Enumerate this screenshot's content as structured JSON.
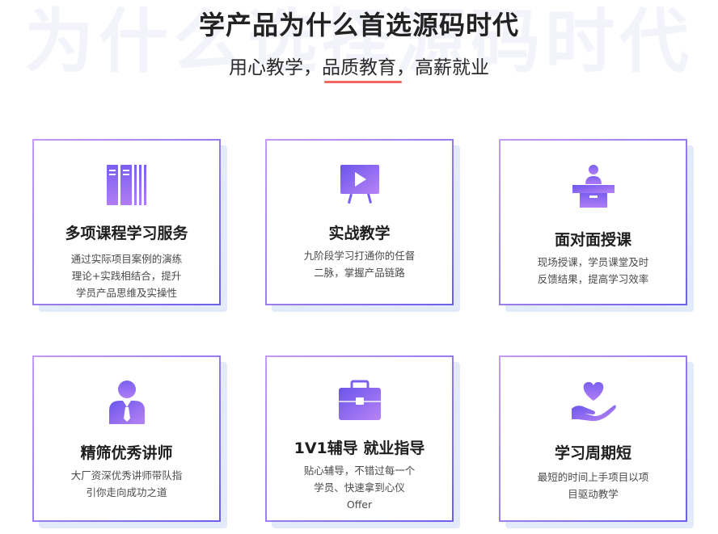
{
  "header": {
    "watermark": "为什么选择源码时代",
    "title": "学产品为什么首选源码时代",
    "subtitle": "用心教学，品质教育，高薪就业"
  },
  "colors": {
    "accent_purple": "#8a5cf0",
    "accent_red": "#f0685f",
    "shadow": "#e3ebfb"
  },
  "cards": [
    {
      "icon": "books-icon",
      "title": "多项课程学习服务",
      "desc": [
        "通过实际项目案例的演练",
        "理论+实践相结合，提升",
        "学员产品思维及实操性"
      ]
    },
    {
      "icon": "presentation-board-icon",
      "title": "实战教学",
      "desc": [
        "九阶段学习打通你的任督",
        "二脉，掌握产品链路"
      ]
    },
    {
      "icon": "lecturer-podium-icon",
      "title": "面对面授课",
      "desc": [
        "现场授课，学员课堂及时",
        "反馈结果，提高学习效率"
      ]
    },
    {
      "icon": "instructor-icon",
      "title": "精筛优秀讲师",
      "desc": [
        "大厂资深优秀讲师带队指",
        "引你走向成功之道"
      ]
    },
    {
      "icon": "briefcase-icon",
      "title": "1V1辅导 就业指导",
      "desc": [
        "贴心辅导，不错过每一个",
        "学员、快速拿到心仪",
        "Offer"
      ]
    },
    {
      "icon": "heart-hand-icon",
      "title": "学习周期短",
      "desc": [
        "最短的时间上手项目以项",
        "目驱动教学"
      ]
    }
  ]
}
